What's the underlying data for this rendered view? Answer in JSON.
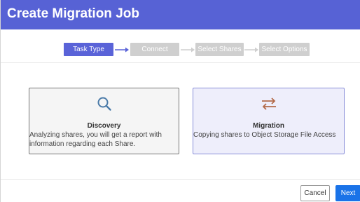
{
  "dialog": {
    "title": "Create Migration Job"
  },
  "stepper": {
    "steps": [
      {
        "label": "Task Type",
        "state": "active"
      },
      {
        "label": "Connect",
        "state": "inactive"
      },
      {
        "label": "Select Shares",
        "state": "inactive"
      },
      {
        "label": "Select Options",
        "state": "inactive"
      }
    ]
  },
  "cards": {
    "discovery": {
      "icon": "magnifier-icon",
      "title": "Discovery",
      "description": "Analyzing shares, you will get a report with information regarding each Share."
    },
    "migration": {
      "icon": "swap-arrows-icon",
      "title": "Migration",
      "description": "Copying shares to Object Storage File Access"
    }
  },
  "footer": {
    "cancel_label": "Cancel",
    "next_label": "Next"
  },
  "colors": {
    "header": "#5762d5",
    "active_step": "#5a63d8",
    "inactive_step": "#cfcfcf",
    "icon": "#4a7aa8",
    "icon_migration": "#b36b4a",
    "next_button": "#1a73e8"
  }
}
